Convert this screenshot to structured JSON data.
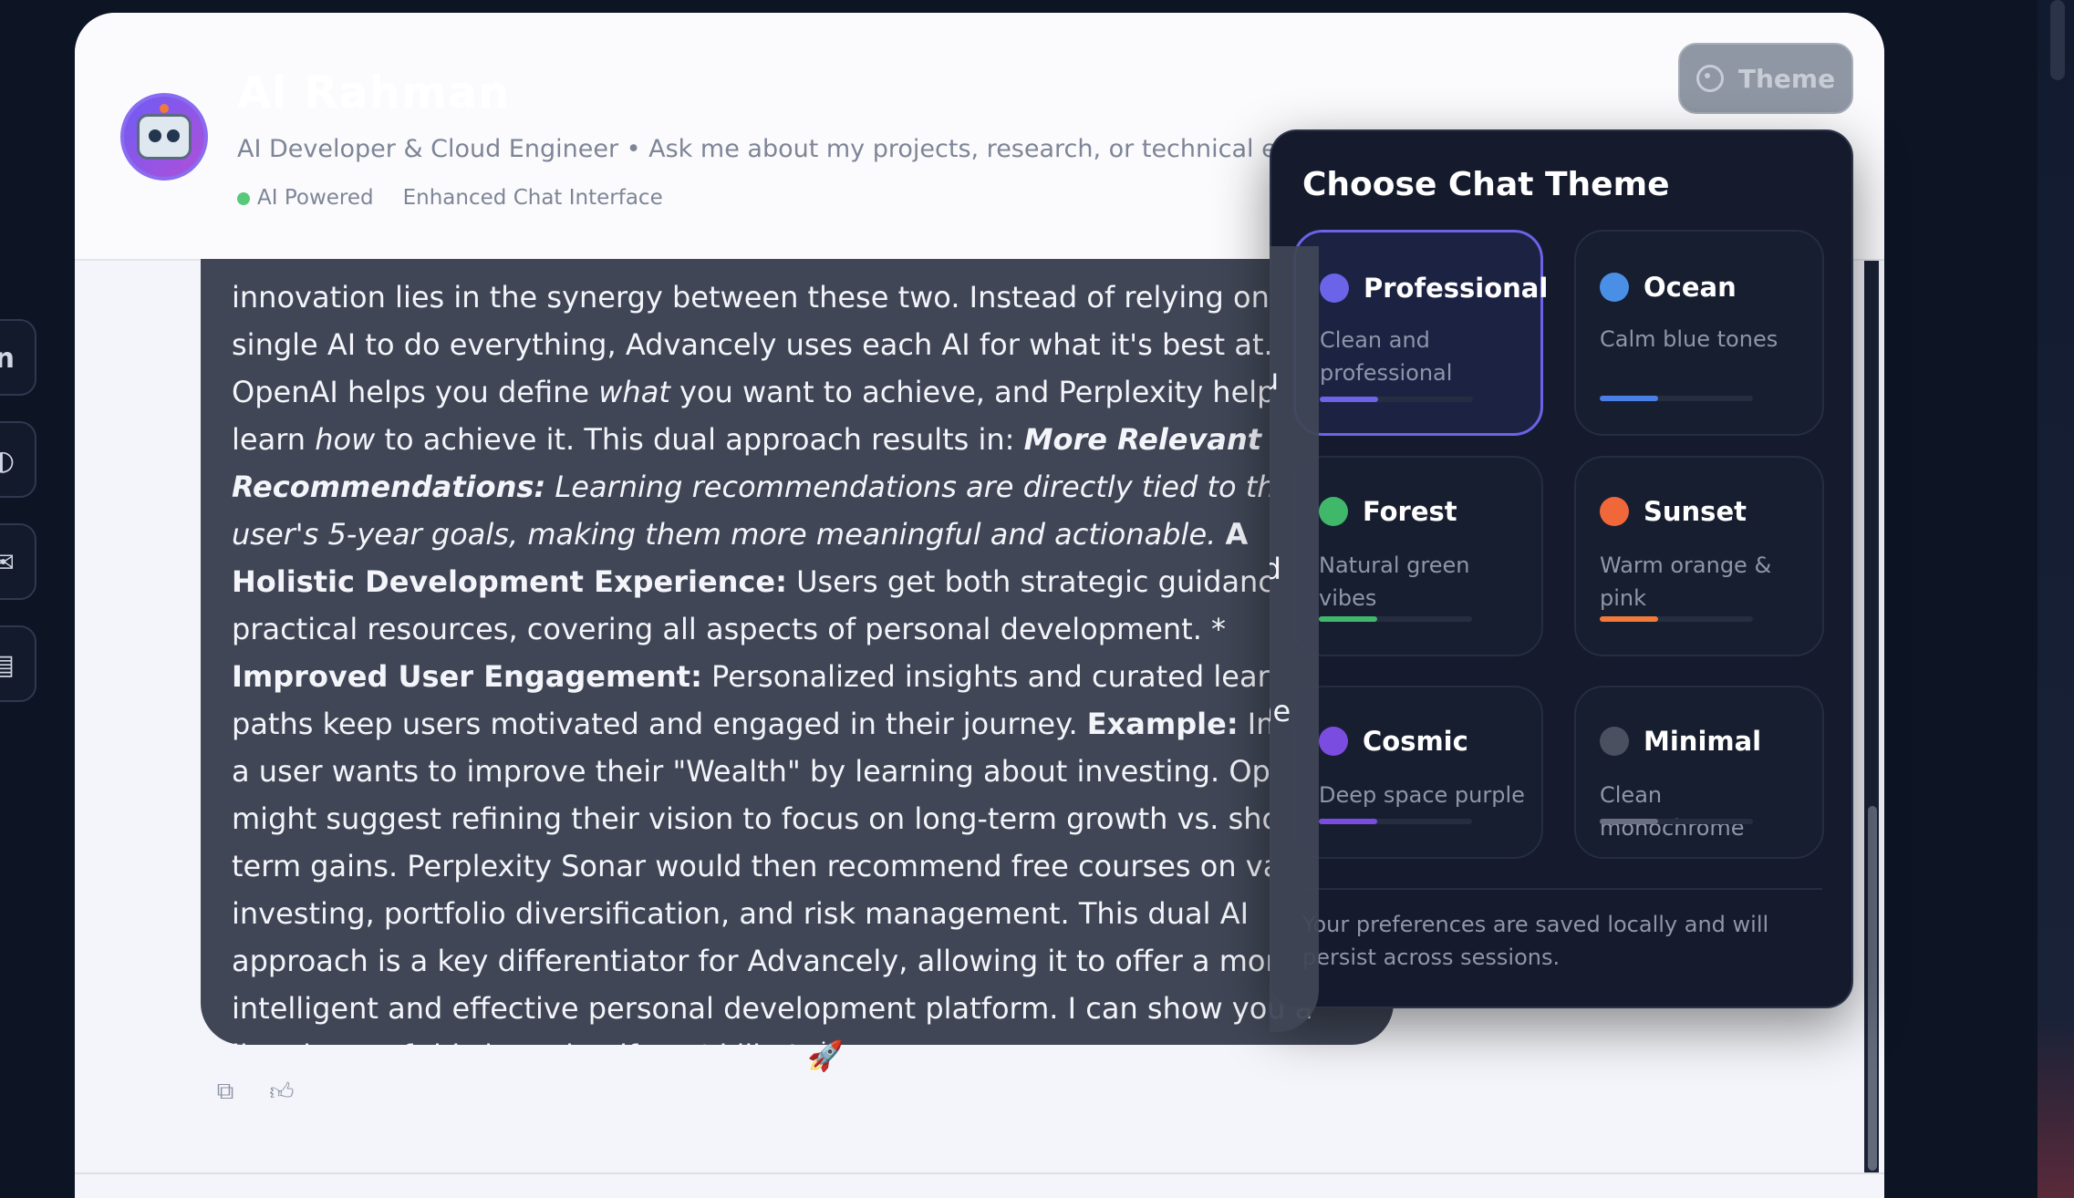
{
  "header": {
    "name": "Al Rahman",
    "subtitle": "AI Developer & Cloud Engineer • Ask me about my projects, research, or technical exp",
    "tag_powered": "AI Powered",
    "tag_interface": "Enhanced Chat Interface",
    "theme_button": "Theme"
  },
  "social_rail": [
    "in",
    "gh",
    "mail",
    "doc"
  ],
  "message": {
    "segments": [
      {
        "t": "innovation lies in the synergy between these two. Instead of relying on a single AI to do everything, Advancely uses each AI for what it's best at. OpenAI helps you define ",
        "s": ""
      },
      {
        "t": "what",
        "s": "i"
      },
      {
        "t": " you want to achieve, and Perplexity helps you learn ",
        "s": ""
      },
      {
        "t": "how",
        "s": "i"
      },
      {
        "t": " to achieve it. This dual approach results in: ",
        "s": ""
      },
      {
        "t": "More Relevant Recommendations:",
        "s": "bi"
      },
      {
        "t": " Learning recommendations are directly tied to the user's 5-year goals, making them more meaningful and actionable.",
        "s": "i"
      },
      {
        "t": " ",
        "s": ""
      },
      {
        "t": "A Holistic Development Experience:",
        "s": "b"
      },
      {
        "t": " Users get both strategic guidance and practical resources, covering all aspects of personal development. * ",
        "s": ""
      },
      {
        "t": "Improved User Engagement:",
        "s": "b"
      },
      {
        "t": " Personalized insights and curated learning paths keep users motivated and engaged in their journey. ",
        "s": ""
      },
      {
        "t": "Example:",
        "s": "b"
      },
      {
        "t": " Imagine a user wants to improve their \"Wealth\" by learning about investing. OpenAI might suggest refining their vision to focus on long-term growth vs. short-term gains. Perplexity Sonar would then recommend free courses on value investing, portfolio diversification, and risk management. This dual AI approach is a key differentiator for Advancely, allowing it to offer a more intelligent and effective personal development platform. I can show you a live demo of this in action if you'd like! 🚀",
        "s": ""
      }
    ]
  },
  "popover": {
    "title": "Choose Chat Theme",
    "themes": [
      {
        "name": "Professional",
        "desc": "Clean and professional",
        "color": "#6b63e8",
        "bar": "#6b63e8",
        "selected": true
      },
      {
        "name": "Ocean",
        "desc": "Calm blue tones",
        "color": "#4a8fe6",
        "bar": "#4a7fe6",
        "selected": false
      },
      {
        "name": "Forest",
        "desc": "Natural green vibes",
        "color": "#3fb86a",
        "bar": "#3fb86a",
        "selected": false
      },
      {
        "name": "Sunset",
        "desc": "Warm orange & pink",
        "color": "#f0683a",
        "bar": "#f07a3a",
        "selected": false
      },
      {
        "name": "Cosmic",
        "desc": "Deep space purple",
        "color": "#7a4ce0",
        "bar": "#7a4ce0",
        "selected": false
      },
      {
        "name": "Minimal",
        "desc": "Clean monochrome",
        "color": "#4a5060",
        "bar": "#6a7080",
        "selected": false
      }
    ],
    "footer": "Your preferences are saved locally and will persist across sessions."
  }
}
